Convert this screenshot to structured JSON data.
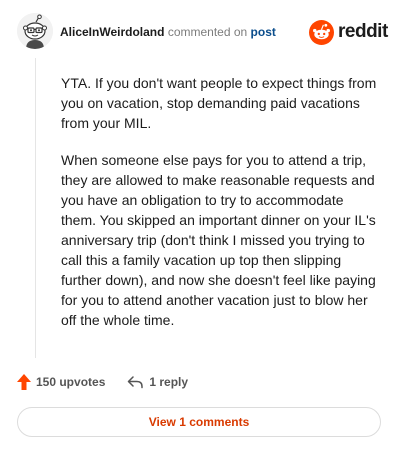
{
  "header": {
    "username": "AliceInWeirdoland",
    "action_text": "commented on",
    "post_link": "post",
    "logo_text": "reddit"
  },
  "comment": {
    "paragraphs": [
      "YTA. If you don't want people to expect things from you on vacation, stop demanding paid vacations from your MIL.",
      "When someone else pays for you to attend a trip, they are allowed to make reasonable requests and you have an obligation to try to accommodate them. You skipped an important dinner on your IL's anniversary trip (don't think I missed you trying to call this a family vacation up top then slipping further down), and now she doesn't feel like paying for you to attend another vacation just to blow her off the whole time."
    ]
  },
  "actions": {
    "upvotes_label": "150 upvotes",
    "reply_label": "1 reply"
  },
  "footer": {
    "view_comments_label": "View 1 comments"
  },
  "colors": {
    "brand_orange": "#ff4500",
    "link_blue": "#0a4d8c",
    "view_button_text": "#d93a00"
  },
  "icons": {
    "avatar": "snoo-avatar-icon",
    "logo": "reddit-logo-icon",
    "upvote": "upvote-arrow-icon",
    "reply": "reply-arrow-icon"
  }
}
